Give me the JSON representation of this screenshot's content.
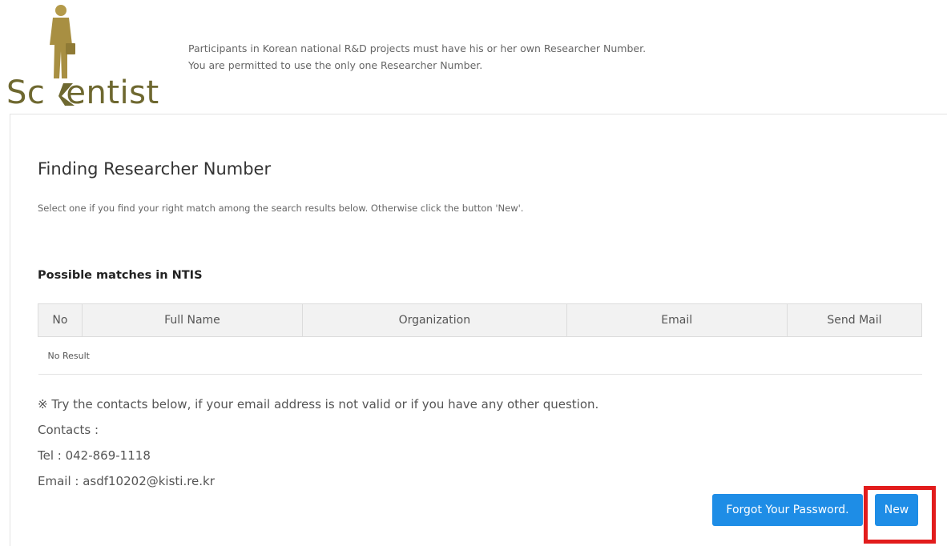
{
  "header": {
    "logo_text_left": "Sc",
    "logo_text_right": "entist",
    "notice_line1": "Participants in Korean national R&D projects must have his or her own Researcher Number.",
    "notice_line2": "You are permitted to use the only one Researcher Number."
  },
  "main": {
    "title": "Finding Researcher Number",
    "subtitle": "Select one if you find your right match among the search results below. Otherwise click the button 'New'.",
    "section_title": "Possible matches in NTIS",
    "table": {
      "columns": [
        "No",
        "Full Name",
        "Organization",
        "Email",
        "Send Mail"
      ],
      "empty_message": "No Result"
    },
    "info": {
      "line1": "※ Try the contacts below, if your email address is not valid or if you have any other question.",
      "line2": "Contacts :",
      "line3": "Tel : 042-869-1118",
      "line4": "Email : asdf10202@kisti.re.kr"
    },
    "buttons": {
      "forgot_label": "Forgot Your Password.",
      "new_label": "New"
    }
  },
  "colors": {
    "button": "#1e8de6",
    "highlight": "#e21c1c",
    "logo": "#6e6830"
  }
}
